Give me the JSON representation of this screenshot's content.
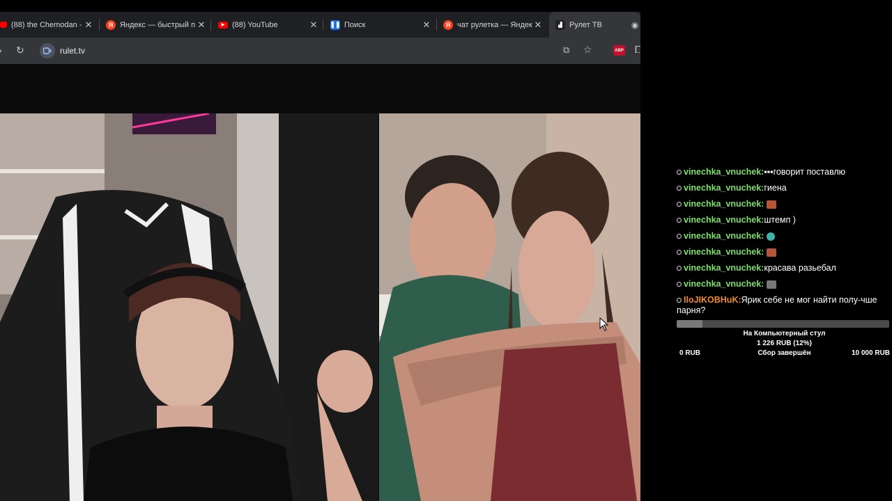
{
  "tabs": [
    {
      "title": "(88) the Chemodan -",
      "icon": "youtube-icon",
      "color": "#ff0000"
    },
    {
      "title": "Яндекс — быстрый п",
      "icon": "yandex-icon",
      "color": "#fc3f1d"
    },
    {
      "title": "(88) YouTube",
      "icon": "youtube-icon",
      "color": "#ff0000"
    },
    {
      "title": "Поиск",
      "icon": "pause-icon",
      "color": "#1a73e8"
    },
    {
      "title": "чат рулетка — Яндек",
      "icon": "yandex-icon",
      "color": "#fc3f1d"
    },
    {
      "title": "Рулет ТВ",
      "icon": "rulet-icon",
      "color": "#222"
    }
  ],
  "address_bar": {
    "url": "rulet.tv"
  },
  "extension": {
    "label": "ABP"
  },
  "chat": {
    "messages": [
      {
        "nick": "vinechka_vnuchek:",
        "text": "▪▪▪говорит поставлю",
        "emote": null
      },
      {
        "nick": "vinechka_vnuchek:",
        "text": "гиена",
        "emote": null
      },
      {
        "nick": "vinechka_vnuchek:",
        "text": "",
        "emote": "#b5553a"
      },
      {
        "nick": "vinechka_vnuchek:",
        "text": "штемп )",
        "emote": null
      },
      {
        "nick": "vinechka_vnuchek:",
        "text": "",
        "emote": "#3fb2a8"
      },
      {
        "nick": "vinechka_vnuchek:",
        "text": "",
        "emote": "#b5553a"
      },
      {
        "nick": "vinechka_vnuchek:",
        "text": "красава разьебал",
        "emote": null
      },
      {
        "nick": "vinechka_vnuchek:",
        "text": "",
        "emote": "#777777"
      },
      {
        "nick": "IloJIKOBHuK:",
        "text": "Ярик себе не мог найти полу-чше парня?",
        "emote": null
      }
    ]
  },
  "goal": {
    "title": "На Компьютерный стул",
    "amount": "1 226 RUB (12%)",
    "progress_fraction": 0.12,
    "min": "0 RUB",
    "status": "Сбор завершён",
    "max": "10 000 RUB"
  }
}
